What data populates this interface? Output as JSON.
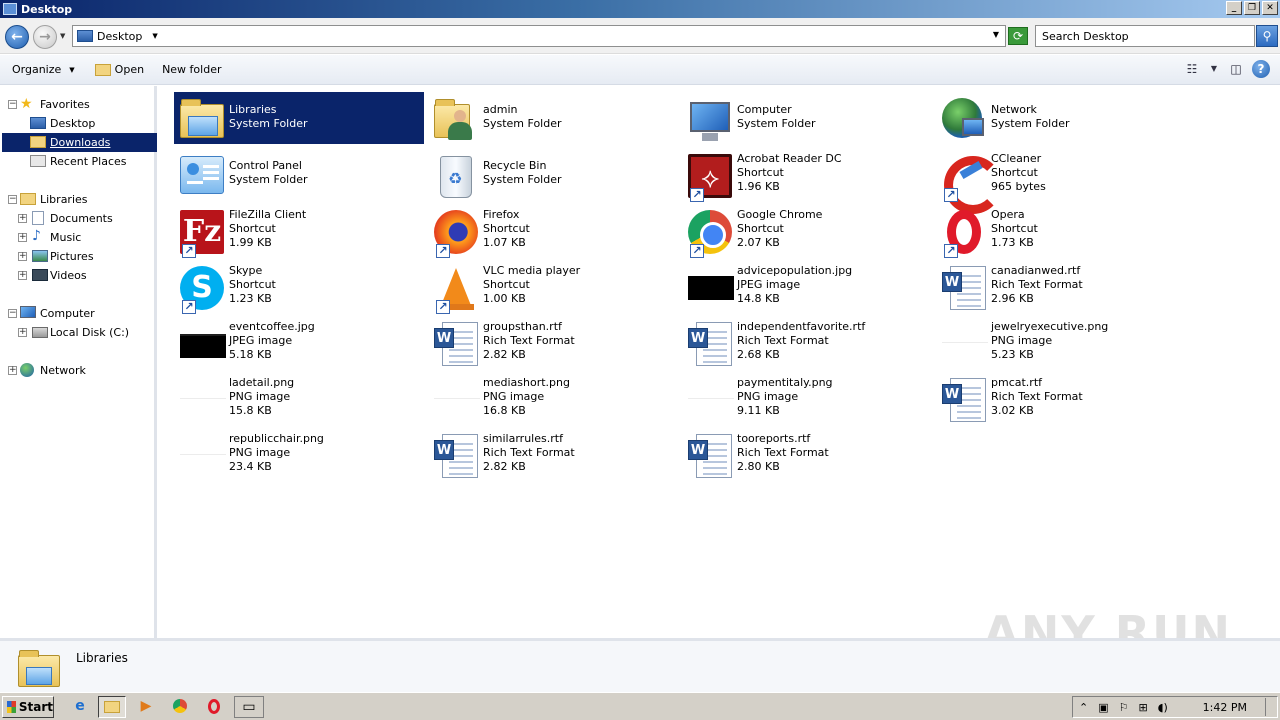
{
  "window": {
    "title": "Desktop",
    "controls": [
      "minimize",
      "restore",
      "close"
    ]
  },
  "address": {
    "location": "Desktop",
    "search_placeholder": "Search Desktop"
  },
  "toolbar": {
    "organize_label": "Organize",
    "open_label": "Open",
    "new_folder_label": "New folder"
  },
  "nav": {
    "favorites": "Favorites",
    "desktop": "Desktop",
    "downloads": "Downloads",
    "recent_places": "Recent Places",
    "libraries": "Libraries",
    "documents": "Documents",
    "music": "Music",
    "pictures": "Pictures",
    "videos": "Videos",
    "computer": "Computer",
    "local_disk": "Local Disk (C:)",
    "network": "Network"
  },
  "items": [
    {
      "name": "Libraries",
      "type": "System Folder",
      "size": "",
      "icon": "libraries-icon"
    },
    {
      "name": "admin",
      "type": "System Folder",
      "size": "",
      "icon": "user-folder-icon"
    },
    {
      "name": "Computer",
      "type": "System Folder",
      "size": "",
      "icon": "computer-icon"
    },
    {
      "name": "Network",
      "type": "System Folder",
      "size": "",
      "icon": "network-icon"
    },
    {
      "name": "Control Panel",
      "type": "System Folder",
      "size": "",
      "icon": "control-panel-icon"
    },
    {
      "name": "Recycle Bin",
      "type": "System Folder",
      "size": "",
      "icon": "recycle-bin-icon"
    },
    {
      "name": "Acrobat Reader DC",
      "type": "Shortcut",
      "size": "1.96 KB",
      "icon": "acrobat-icon"
    },
    {
      "name": "CCleaner",
      "type": "Shortcut",
      "size": "965 bytes",
      "icon": "ccleaner-icon"
    },
    {
      "name": "FileZilla Client",
      "type": "Shortcut",
      "size": "1.99 KB",
      "icon": "filezilla-icon"
    },
    {
      "name": "Firefox",
      "type": "Shortcut",
      "size": "1.07 KB",
      "icon": "firefox-icon"
    },
    {
      "name": "Google Chrome",
      "type": "Shortcut",
      "size": "2.07 KB",
      "icon": "chrome-icon"
    },
    {
      "name": "Opera",
      "type": "Shortcut",
      "size": "1.73 KB",
      "icon": "opera-icon"
    },
    {
      "name": "Skype",
      "type": "Shortcut",
      "size": "1.23 KB",
      "icon": "skype-icon"
    },
    {
      "name": "VLC media player",
      "type": "Shortcut",
      "size": "1.00 KB",
      "icon": "vlc-icon"
    },
    {
      "name": "advicepopulation.jpg",
      "type": "JPEG image",
      "size": "14.8 KB",
      "icon": "jpeg-thumbnail-icon"
    },
    {
      "name": "canadianwed.rtf",
      "type": "Rich Text Format",
      "size": "2.96 KB",
      "icon": "rtf-document-icon"
    },
    {
      "name": "eventcoffee.jpg",
      "type": "JPEG image",
      "size": "5.18 KB",
      "icon": "jpeg-thumbnail-icon"
    },
    {
      "name": "groupsthan.rtf",
      "type": "Rich Text Format",
      "size": "2.82 KB",
      "icon": "rtf-document-icon"
    },
    {
      "name": "independentfavorite.rtf",
      "type": "Rich Text Format",
      "size": "2.68 KB",
      "icon": "rtf-document-icon"
    },
    {
      "name": "jewelryexecutive.png",
      "type": "PNG image",
      "size": "5.23 KB",
      "icon": "png-thumbnail-icon"
    },
    {
      "name": "ladetail.png",
      "type": "PNG image",
      "size": "15.8 KB",
      "icon": "png-thumbnail-icon"
    },
    {
      "name": "mediashort.png",
      "type": "PNG image",
      "size": "16.8 KB",
      "icon": "png-thumbnail-icon"
    },
    {
      "name": "paymentitaly.png",
      "type": "PNG image",
      "size": "9.11 KB",
      "icon": "png-thumbnail-icon"
    },
    {
      "name": "pmcat.rtf",
      "type": "Rich Text Format",
      "size": "3.02 KB",
      "icon": "rtf-document-icon"
    },
    {
      "name": "republicchair.png",
      "type": "PNG image",
      "size": "23.4 KB",
      "icon": "png-thumbnail-icon"
    },
    {
      "name": "similarrules.rtf",
      "type": "Rich Text Format",
      "size": "2.82 KB",
      "icon": "rtf-document-icon"
    },
    {
      "name": "tooreports.rtf",
      "type": "Rich Text Format",
      "size": "2.80 KB",
      "icon": "rtf-document-icon"
    }
  ],
  "details": {
    "selected_name": "Libraries"
  },
  "watermark": "ANY RUN",
  "taskbar": {
    "start_label": "Start",
    "clock": "1:42 PM"
  },
  "colors": {
    "selection": "#0a246a",
    "titlebar_start": "#0a246a",
    "titlebar_end": "#a6caf0"
  }
}
